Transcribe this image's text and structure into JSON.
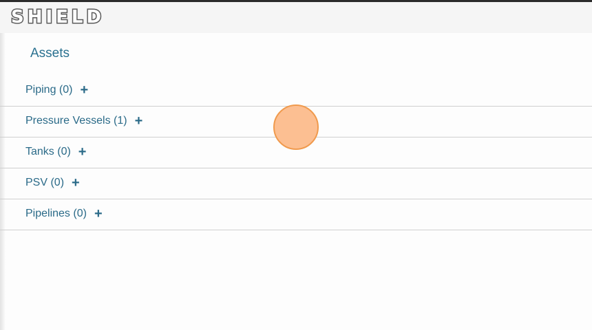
{
  "app": {
    "logo_text": "SHIELD"
  },
  "main": {
    "title": "Assets",
    "assets": [
      {
        "label": "Piping (0)",
        "action_icon": "plus-icon"
      },
      {
        "label": "Pressure Vessels (1)",
        "action_icon": "plus-icon"
      },
      {
        "label": "Tanks (0)",
        "action_icon": "plus-icon"
      },
      {
        "label": "PSV (0)",
        "action_icon": "plus-icon"
      },
      {
        "label": "Pipelines (0)",
        "action_icon": "plus-icon"
      }
    ]
  },
  "colors": {
    "accent": "#2a6a88",
    "touch_indicator": "#fcbf92"
  }
}
